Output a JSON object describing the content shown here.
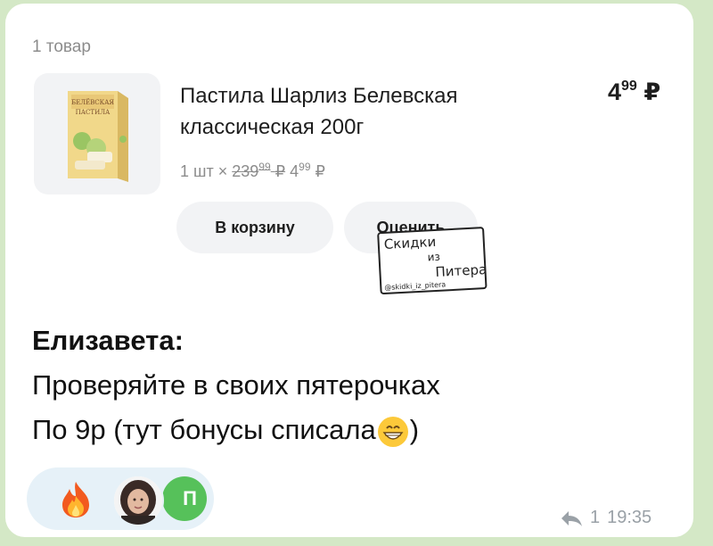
{
  "item_count": "1 товар",
  "product": {
    "name": "Пастила Шарлиз Белевская классическая 200г",
    "total_main": "4",
    "total_cents": "99",
    "currency": "₽",
    "qty_prefix": "1 шт ×",
    "old_main": "239",
    "old_cents": "99",
    "new_main": "4",
    "new_cents": "99"
  },
  "buttons": {
    "cart": "В корзину",
    "rate": "Оценить"
  },
  "stamp": {
    "line1": "Скидки",
    "line2": "из",
    "line3": "Питера",
    "handle": "@skidki_iz_pitera"
  },
  "message": {
    "author": "Елизавета:",
    "line1": "Проверяйте в своих пятерочках",
    "line2": "По 9р (тут бонусы списала",
    "line2_end": ")"
  },
  "reactions": {
    "emoji": "fire-emoji",
    "avatar_letter": "П"
  },
  "footer": {
    "reply_count": "1",
    "time": "19:35"
  },
  "colors": {
    "chat_bg": "#d4e8c6",
    "bubble_bg": "#ffffff",
    "card_gray": "#f2f3f5",
    "reaction_bg": "#e6f1f8",
    "avatar_green": "#56c15a",
    "meta_gray": "#9aa1a7"
  }
}
